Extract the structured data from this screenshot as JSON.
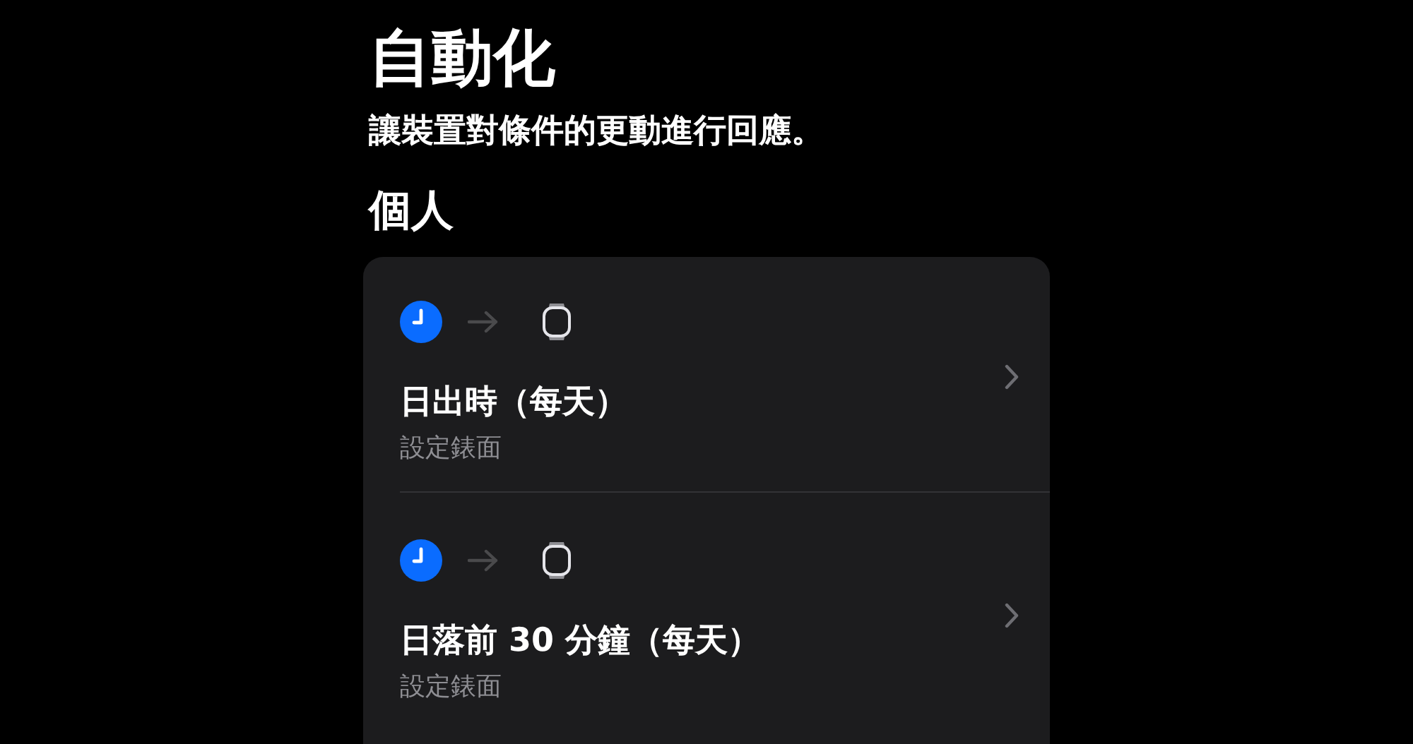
{
  "title": "自動化",
  "subtitle": "讓裝置對條件的更動進行回應。",
  "section": "個人",
  "automations": [
    {
      "title": "日出時（每天）",
      "action": "設定錶面"
    },
    {
      "title": "日落前 30 分鐘（每天）",
      "action": "設定錶面"
    }
  ]
}
